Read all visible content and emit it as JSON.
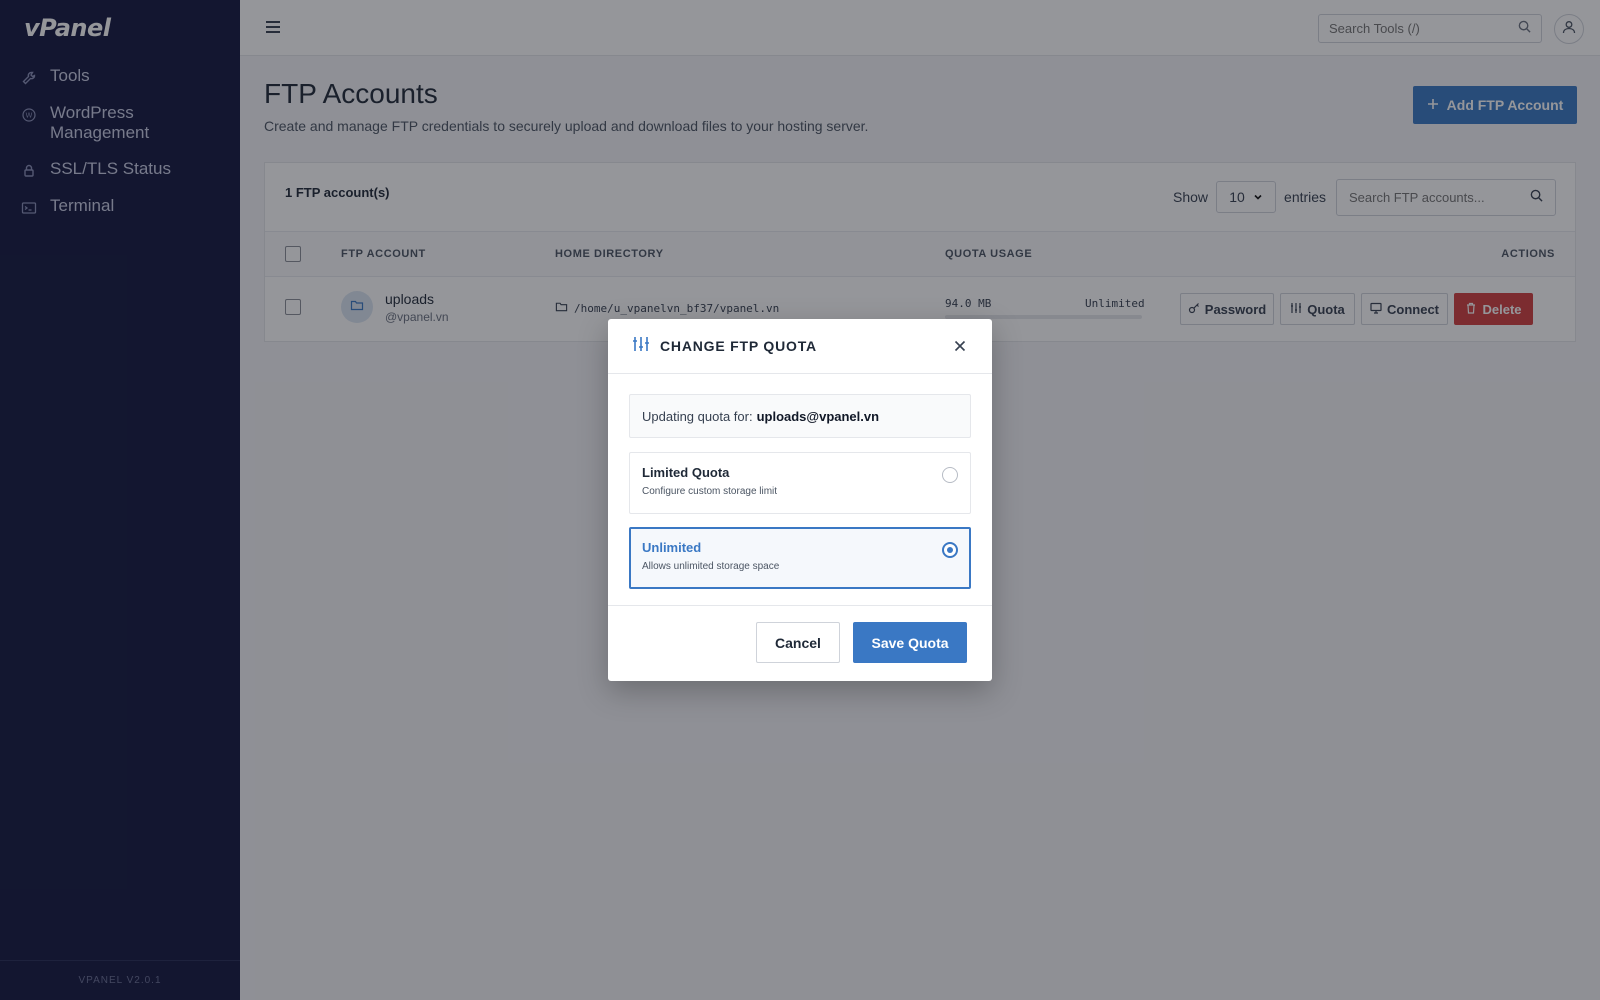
{
  "app": {
    "logo": "vPanel",
    "version": "VPANEL V2.0.1"
  },
  "sidebar": {
    "items": [
      {
        "label": "Tools",
        "icon": "wrench-icon"
      },
      {
        "label": "WordPress Management",
        "icon": "wordpress-icon"
      },
      {
        "label": "SSL/TLS Status",
        "icon": "lock-icon"
      },
      {
        "label": "Terminal",
        "icon": "terminal-icon"
      }
    ]
  },
  "topbar": {
    "search_placeholder": "Search Tools (/)"
  },
  "page": {
    "title": "FTP Accounts",
    "subtitle": "Create and manage FTP credentials to securely upload and download files to your hosting server.",
    "add_button": "Add FTP Account"
  },
  "table": {
    "count": "1 FTP account(s)",
    "show_label": "Show",
    "entries_value": "10",
    "entries_label": "entries",
    "search_placeholder": "Search FTP accounts...",
    "headers": {
      "account": "FTP ACCOUNT",
      "home": "HOME DIRECTORY",
      "quota": "QUOTA USAGE",
      "actions": "ACTIONS"
    },
    "rows": [
      {
        "name": "uploads",
        "domain": "@vpanel.vn",
        "home_dir": "/home/u_vpanelvn_bf37/vpanel.vn",
        "quota_used": "94.0 MB",
        "quota_limit": "Unlimited",
        "quota_fraction": 0.0
      }
    ],
    "actions": {
      "password": "Password",
      "quota": "Quota",
      "connect": "Connect",
      "delete": "Delete"
    }
  },
  "modal": {
    "title": "CHANGE FTP QUOTA",
    "info_prefix": "Updating quota for:",
    "info_account": "uploads@vpanel.vn",
    "options": [
      {
        "title": "Limited Quota",
        "desc": "Configure custom storage limit",
        "selected": false
      },
      {
        "title": "Unlimited",
        "desc": "Allows unlimited storage space",
        "selected": true
      }
    ],
    "cancel": "Cancel",
    "save": "Save Quota"
  },
  "colors": {
    "sidebar_bg": "#13173f",
    "accent": "#3a78c4",
    "danger": "#d13f3f"
  }
}
